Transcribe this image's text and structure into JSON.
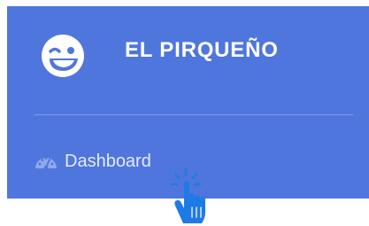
{
  "brand": {
    "title": "EL PIRQUEÑO",
    "icon": "winking-face-icon"
  },
  "nav": {
    "items": [
      {
        "label": "Dashboard",
        "icon": "tachometer-icon"
      }
    ]
  },
  "cursor": {
    "icon": "hand-pointer-click-icon"
  },
  "colors": {
    "sidebar_bg": "#4f76dc",
    "brand_text": "#ffffff",
    "nav_text": "#e6ebfa",
    "cursor_fill": "#1e7be6"
  }
}
